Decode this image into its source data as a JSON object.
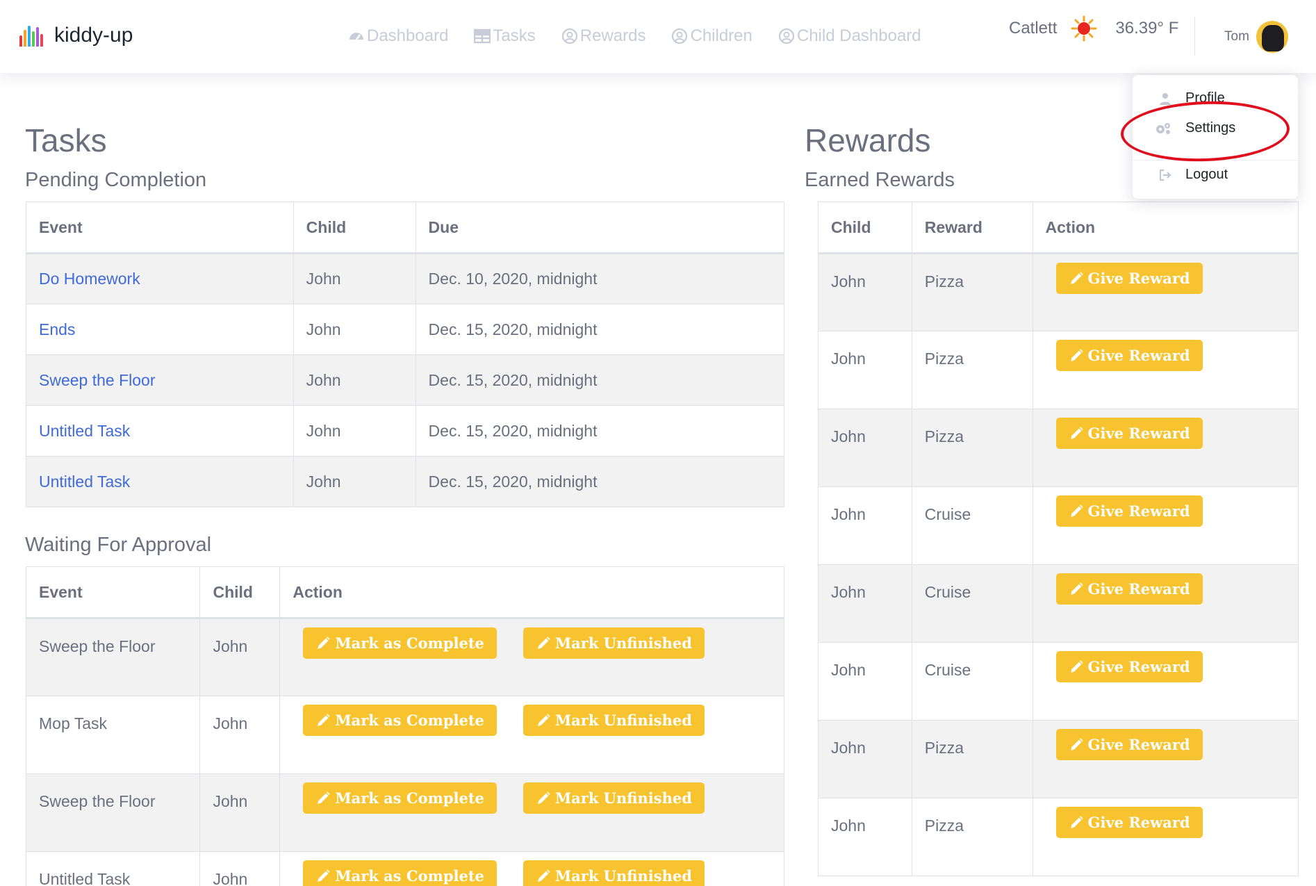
{
  "brand": {
    "name": "kiddy-up",
    "colors": [
      "#e23b3b",
      "#f7a12e",
      "#3aa8e8",
      "#5bc45b",
      "#a55bd6",
      "#e8435f"
    ]
  },
  "nav": {
    "items": [
      {
        "label": "Dashboard",
        "icon": "speedometer-icon"
      },
      {
        "label": "Tasks",
        "icon": "table-icon"
      },
      {
        "label": "Rewards",
        "icon": "user-circle-icon"
      },
      {
        "label": "Children",
        "icon": "user-circle-icon"
      },
      {
        "label": "Child Dashboard",
        "icon": "user-circle-icon"
      }
    ]
  },
  "weather": {
    "location": "Catlett",
    "temperature": "36.39° F",
    "icon": "sun-icon"
  },
  "user": {
    "name": "Tom",
    "icon": "avatar"
  },
  "dropdown": {
    "items": [
      {
        "label": "Profile",
        "icon": "user-icon"
      },
      {
        "label": "Settings",
        "icon": "gears-icon"
      },
      {
        "label": "Logout",
        "icon": "sign-out-icon"
      }
    ],
    "highlight_color": "#e00d1d"
  },
  "tasks": {
    "title": "Tasks",
    "pending": {
      "subtitle": "Pending Completion",
      "headers": [
        "Event",
        "Child",
        "Due"
      ],
      "rows": [
        {
          "event": "Do Homework",
          "child": "John",
          "due": "Dec. 10, 2020, midnight"
        },
        {
          "event": "Ends",
          "child": "John",
          "due": "Dec. 15, 2020, midnight"
        },
        {
          "event": "Sweep the Floor",
          "child": "John",
          "due": "Dec. 15, 2020, midnight"
        },
        {
          "event": "Untitled Task",
          "child": "John",
          "due": "Dec. 15, 2020, midnight"
        },
        {
          "event": "Untitled Task",
          "child": "John",
          "due": "Dec. 15, 2020, midnight"
        }
      ]
    },
    "approval": {
      "subtitle": "Waiting For Approval",
      "headers": [
        "Event",
        "Child",
        "Action"
      ],
      "complete_label": "Mark as Complete",
      "unfinished_label": "Mark Unfinished",
      "rows": [
        {
          "event": "Sweep the Floor",
          "child": "John"
        },
        {
          "event": "Mop Task",
          "child": "John"
        },
        {
          "event": "Sweep the Floor",
          "child": "John"
        },
        {
          "event": "Untitled Task",
          "child": "John"
        }
      ]
    }
  },
  "rewards": {
    "title": "Rewards",
    "subtitle": "Earned Rewards",
    "headers": [
      "Child",
      "Reward",
      "Action"
    ],
    "give_label": "Give Reward",
    "rows": [
      {
        "child": "John",
        "reward": "Pizza"
      },
      {
        "child": "John",
        "reward": "Pizza"
      },
      {
        "child": "John",
        "reward": "Pizza"
      },
      {
        "child": "John",
        "reward": "Cruise"
      },
      {
        "child": "John",
        "reward": "Cruise"
      },
      {
        "child": "John",
        "reward": "Cruise"
      },
      {
        "child": "John",
        "reward": "Pizza"
      },
      {
        "child": "John",
        "reward": "Pizza"
      }
    ]
  },
  "colors": {
    "accent": "#f7c32e",
    "link": "#3f6ad8",
    "nav_inactive": "#c9ccd8",
    "text": "#6c6f7e"
  }
}
